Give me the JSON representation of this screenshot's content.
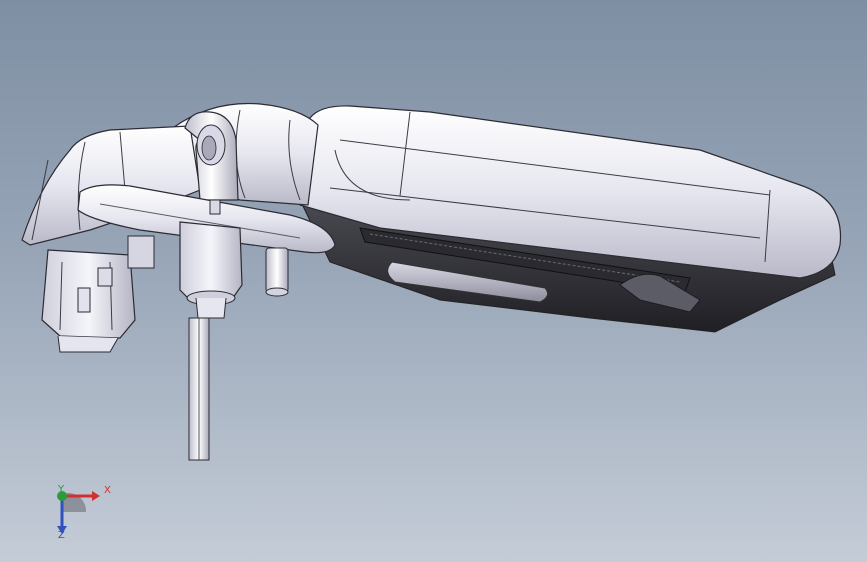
{
  "viewport": {
    "background_top": "#7f8fa3",
    "background_bottom": "#c4ccd7"
  },
  "model": {
    "description_icon": "cad-housing-model",
    "body_color": "#e9e9f2",
    "shadow_color": "#2a2a30",
    "edge_color": "#2b2b33"
  },
  "triad": {
    "x_label": "X",
    "y_label": "Y",
    "z_label": "Z",
    "x_color": "#d03030",
    "y_color": "#2f9a3a",
    "z_color": "#3050c0"
  }
}
